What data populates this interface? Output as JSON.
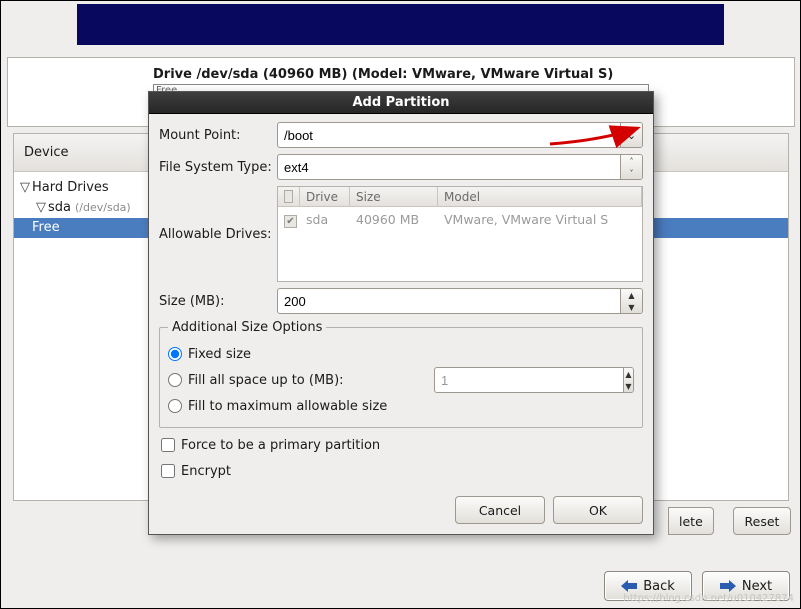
{
  "banner": {},
  "drive_summary": "Drive /dev/sda (40960 MB) (Model: VMware, VMware Virtual S)",
  "drive_bar_text": "Free",
  "tree": {
    "header_device": "Device",
    "root": "Hard Drives",
    "sda_label": "sda",
    "sda_path": "(/dev/sda)",
    "free": "Free"
  },
  "bg": {
    "delete_partial": "lete",
    "reset": "Reset",
    "back": "Back",
    "next": "Next"
  },
  "dialog": {
    "title": "Add Partition",
    "mount_point_label": "Mount Point:",
    "mount_point_value": "/boot",
    "fs_type_label": "File System Type:",
    "fs_type_value": "ext4",
    "allowable_label": "Allowable Drives:",
    "drives_header": {
      "drive": "Drive",
      "size": "Size",
      "model": "Model"
    },
    "drives_row": {
      "name": "sda",
      "size": "40960 MB",
      "model": "VMware, VMware Virtual S"
    },
    "size_label": "Size (MB):",
    "size_value": "200",
    "addl_legend": "Additional Size Options",
    "opt_fixed": "Fixed size",
    "opt_fill_up_to": "Fill all space up to (MB):",
    "opt_fill_up_to_value": "1",
    "opt_fill_max": "Fill to maximum allowable size",
    "force_primary": "Force to be a primary partition",
    "encrypt": "Encrypt",
    "cancel": "Cancel",
    "ok": "OK"
  },
  "watermark": "https://blog.csdn.net/u010427874"
}
